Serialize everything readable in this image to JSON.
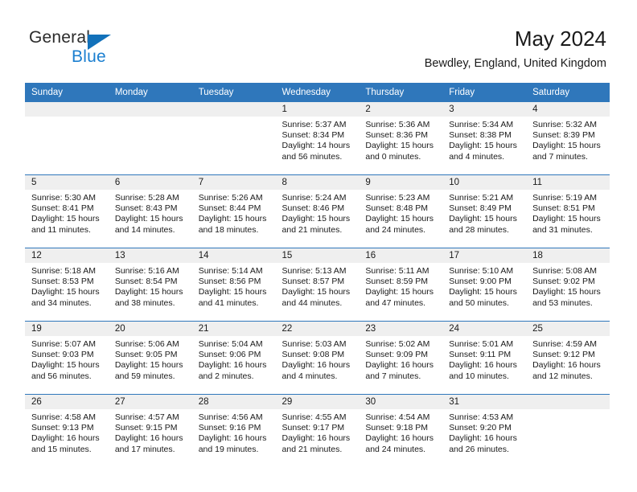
{
  "brand": {
    "name_top": "General",
    "name_bottom": "Blue",
    "triangle_icon": "blue-triangle-logo-mark",
    "accent_color": "#1b7fd0",
    "triangle_color": "#1271ba"
  },
  "header": {
    "title": "May 2024",
    "subtitle": "Bewdley, England, United Kingdom"
  },
  "theme": {
    "header_row_bg": "#2f77bb",
    "header_row_text": "#ffffff",
    "day_band_bg": "#efefef",
    "row_divider": "#2f77bb",
    "body_text": "#1a1a1a"
  },
  "weekday_headers": [
    "Sunday",
    "Monday",
    "Tuesday",
    "Wednesday",
    "Thursday",
    "Friday",
    "Saturday"
  ],
  "weeks": [
    [
      {
        "day": "",
        "sunrise": "",
        "sunset": "",
        "daylight_1": "",
        "daylight_2": "",
        "empty": true
      },
      {
        "day": "",
        "sunrise": "",
        "sunset": "",
        "daylight_1": "",
        "daylight_2": "",
        "empty": true
      },
      {
        "day": "",
        "sunrise": "",
        "sunset": "",
        "daylight_1": "",
        "daylight_2": "",
        "empty": true
      },
      {
        "day": "1",
        "sunrise": "Sunrise: 5:37 AM",
        "sunset": "Sunset: 8:34 PM",
        "daylight_1": "Daylight: 14 hours",
        "daylight_2": "and 56 minutes."
      },
      {
        "day": "2",
        "sunrise": "Sunrise: 5:36 AM",
        "sunset": "Sunset: 8:36 PM",
        "daylight_1": "Daylight: 15 hours",
        "daylight_2": "and 0 minutes."
      },
      {
        "day": "3",
        "sunrise": "Sunrise: 5:34 AM",
        "sunset": "Sunset: 8:38 PM",
        "daylight_1": "Daylight: 15 hours",
        "daylight_2": "and 4 minutes."
      },
      {
        "day": "4",
        "sunrise": "Sunrise: 5:32 AM",
        "sunset": "Sunset: 8:39 PM",
        "daylight_1": "Daylight: 15 hours",
        "daylight_2": "and 7 minutes."
      }
    ],
    [
      {
        "day": "5",
        "sunrise": "Sunrise: 5:30 AM",
        "sunset": "Sunset: 8:41 PM",
        "daylight_1": "Daylight: 15 hours",
        "daylight_2": "and 11 minutes."
      },
      {
        "day": "6",
        "sunrise": "Sunrise: 5:28 AM",
        "sunset": "Sunset: 8:43 PM",
        "daylight_1": "Daylight: 15 hours",
        "daylight_2": "and 14 minutes."
      },
      {
        "day": "7",
        "sunrise": "Sunrise: 5:26 AM",
        "sunset": "Sunset: 8:44 PM",
        "daylight_1": "Daylight: 15 hours",
        "daylight_2": "and 18 minutes."
      },
      {
        "day": "8",
        "sunrise": "Sunrise: 5:24 AM",
        "sunset": "Sunset: 8:46 PM",
        "daylight_1": "Daylight: 15 hours",
        "daylight_2": "and 21 minutes."
      },
      {
        "day": "9",
        "sunrise": "Sunrise: 5:23 AM",
        "sunset": "Sunset: 8:48 PM",
        "daylight_1": "Daylight: 15 hours",
        "daylight_2": "and 24 minutes."
      },
      {
        "day": "10",
        "sunrise": "Sunrise: 5:21 AM",
        "sunset": "Sunset: 8:49 PM",
        "daylight_1": "Daylight: 15 hours",
        "daylight_2": "and 28 minutes."
      },
      {
        "day": "11",
        "sunrise": "Sunrise: 5:19 AM",
        "sunset": "Sunset: 8:51 PM",
        "daylight_1": "Daylight: 15 hours",
        "daylight_2": "and 31 minutes."
      }
    ],
    [
      {
        "day": "12",
        "sunrise": "Sunrise: 5:18 AM",
        "sunset": "Sunset: 8:53 PM",
        "daylight_1": "Daylight: 15 hours",
        "daylight_2": "and 34 minutes."
      },
      {
        "day": "13",
        "sunrise": "Sunrise: 5:16 AM",
        "sunset": "Sunset: 8:54 PM",
        "daylight_1": "Daylight: 15 hours",
        "daylight_2": "and 38 minutes."
      },
      {
        "day": "14",
        "sunrise": "Sunrise: 5:14 AM",
        "sunset": "Sunset: 8:56 PM",
        "daylight_1": "Daylight: 15 hours",
        "daylight_2": "and 41 minutes."
      },
      {
        "day": "15",
        "sunrise": "Sunrise: 5:13 AM",
        "sunset": "Sunset: 8:57 PM",
        "daylight_1": "Daylight: 15 hours",
        "daylight_2": "and 44 minutes."
      },
      {
        "day": "16",
        "sunrise": "Sunrise: 5:11 AM",
        "sunset": "Sunset: 8:59 PM",
        "daylight_1": "Daylight: 15 hours",
        "daylight_2": "and 47 minutes."
      },
      {
        "day": "17",
        "sunrise": "Sunrise: 5:10 AM",
        "sunset": "Sunset: 9:00 PM",
        "daylight_1": "Daylight: 15 hours",
        "daylight_2": "and 50 minutes."
      },
      {
        "day": "18",
        "sunrise": "Sunrise: 5:08 AM",
        "sunset": "Sunset: 9:02 PM",
        "daylight_1": "Daylight: 15 hours",
        "daylight_2": "and 53 minutes."
      }
    ],
    [
      {
        "day": "19",
        "sunrise": "Sunrise: 5:07 AM",
        "sunset": "Sunset: 9:03 PM",
        "daylight_1": "Daylight: 15 hours",
        "daylight_2": "and 56 minutes."
      },
      {
        "day": "20",
        "sunrise": "Sunrise: 5:06 AM",
        "sunset": "Sunset: 9:05 PM",
        "daylight_1": "Daylight: 15 hours",
        "daylight_2": "and 59 minutes."
      },
      {
        "day": "21",
        "sunrise": "Sunrise: 5:04 AM",
        "sunset": "Sunset: 9:06 PM",
        "daylight_1": "Daylight: 16 hours",
        "daylight_2": "and 2 minutes."
      },
      {
        "day": "22",
        "sunrise": "Sunrise: 5:03 AM",
        "sunset": "Sunset: 9:08 PM",
        "daylight_1": "Daylight: 16 hours",
        "daylight_2": "and 4 minutes."
      },
      {
        "day": "23",
        "sunrise": "Sunrise: 5:02 AM",
        "sunset": "Sunset: 9:09 PM",
        "daylight_1": "Daylight: 16 hours",
        "daylight_2": "and 7 minutes."
      },
      {
        "day": "24",
        "sunrise": "Sunrise: 5:01 AM",
        "sunset": "Sunset: 9:11 PM",
        "daylight_1": "Daylight: 16 hours",
        "daylight_2": "and 10 minutes."
      },
      {
        "day": "25",
        "sunrise": "Sunrise: 4:59 AM",
        "sunset": "Sunset: 9:12 PM",
        "daylight_1": "Daylight: 16 hours",
        "daylight_2": "and 12 minutes."
      }
    ],
    [
      {
        "day": "26",
        "sunrise": "Sunrise: 4:58 AM",
        "sunset": "Sunset: 9:13 PM",
        "daylight_1": "Daylight: 16 hours",
        "daylight_2": "and 15 minutes."
      },
      {
        "day": "27",
        "sunrise": "Sunrise: 4:57 AM",
        "sunset": "Sunset: 9:15 PM",
        "daylight_1": "Daylight: 16 hours",
        "daylight_2": "and 17 minutes."
      },
      {
        "day": "28",
        "sunrise": "Sunrise: 4:56 AM",
        "sunset": "Sunset: 9:16 PM",
        "daylight_1": "Daylight: 16 hours",
        "daylight_2": "and 19 minutes."
      },
      {
        "day": "29",
        "sunrise": "Sunrise: 4:55 AM",
        "sunset": "Sunset: 9:17 PM",
        "daylight_1": "Daylight: 16 hours",
        "daylight_2": "and 21 minutes."
      },
      {
        "day": "30",
        "sunrise": "Sunrise: 4:54 AM",
        "sunset": "Sunset: 9:18 PM",
        "daylight_1": "Daylight: 16 hours",
        "daylight_2": "and 24 minutes."
      },
      {
        "day": "31",
        "sunrise": "Sunrise: 4:53 AM",
        "sunset": "Sunset: 9:20 PM",
        "daylight_1": "Daylight: 16 hours",
        "daylight_2": "and 26 minutes."
      },
      {
        "day": "",
        "sunrise": "",
        "sunset": "",
        "daylight_1": "",
        "daylight_2": "",
        "empty": true
      }
    ]
  ]
}
